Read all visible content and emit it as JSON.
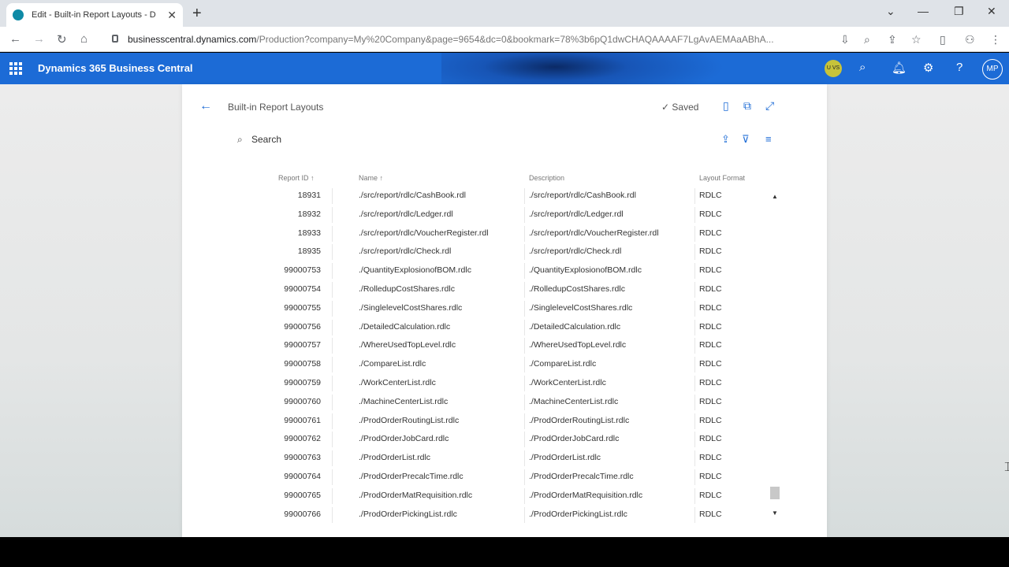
{
  "browser": {
    "tab_title": "Edit - Built-in Report Layouts - D",
    "tab_close": "✕",
    "new_tab": "+",
    "url_host": "businesscentral.dynamics.com",
    "url_path": "/Production?company=My%20Company&page=9654&dc=0&bookmark=78%3b6pQ1dwCHAQAAAAF7LgAvAEMAaABhA..."
  },
  "app": {
    "name": "Dynamics 365 Business Central",
    "company_badge": "U VS",
    "avatar_initials": "MP"
  },
  "page": {
    "title": "Built-in Report Layouts",
    "saved_label": "✓ Saved",
    "search_label": "Search"
  },
  "table": {
    "headers": {
      "report_id": "Report ID ↑",
      "name": "Name ↑",
      "description": "Description",
      "layout_format": "Layout Format"
    },
    "rows": [
      {
        "id": "18931",
        "name": "./src/report/rdlc/CashBook.rdl",
        "desc": "./src/report/rdlc/CashBook.rdl",
        "fmt": "RDLC"
      },
      {
        "id": "18932",
        "name": "./src/report/rdlc/Ledger.rdl",
        "desc": "./src/report/rdlc/Ledger.rdl",
        "fmt": "RDLC"
      },
      {
        "id": "18933",
        "name": "./src/report/rdlc/VoucherRegister.rdl",
        "desc": "./src/report/rdlc/VoucherRegister.rdl",
        "fmt": "RDLC"
      },
      {
        "id": "18935",
        "name": "./src/report/rdlc/Check.rdl",
        "desc": "./src/report/rdlc/Check.rdl",
        "fmt": "RDLC"
      },
      {
        "id": "99000753",
        "name": "./QuantityExplosionofBOM.rdlc",
        "desc": "./QuantityExplosionofBOM.rdlc",
        "fmt": "RDLC"
      },
      {
        "id": "99000754",
        "name": "./RolledupCostShares.rdlc",
        "desc": "./RolledupCostShares.rdlc",
        "fmt": "RDLC"
      },
      {
        "id": "99000755",
        "name": "./SinglelevelCostShares.rdlc",
        "desc": "./SinglelevelCostShares.rdlc",
        "fmt": "RDLC"
      },
      {
        "id": "99000756",
        "name": "./DetailedCalculation.rdlc",
        "desc": "./DetailedCalculation.rdlc",
        "fmt": "RDLC"
      },
      {
        "id": "99000757",
        "name": "./WhereUsedTopLevel.rdlc",
        "desc": "./WhereUsedTopLevel.rdlc",
        "fmt": "RDLC"
      },
      {
        "id": "99000758",
        "name": "./CompareList.rdlc",
        "desc": "./CompareList.rdlc",
        "fmt": "RDLC"
      },
      {
        "id": "99000759",
        "name": "./WorkCenterList.rdlc",
        "desc": "./WorkCenterList.rdlc",
        "fmt": "RDLC"
      },
      {
        "id": "99000760",
        "name": "./MachineCenterList.rdlc",
        "desc": "./MachineCenterList.rdlc",
        "fmt": "RDLC"
      },
      {
        "id": "99000761",
        "name": "./ProdOrderRoutingList.rdlc",
        "desc": "./ProdOrderRoutingList.rdlc",
        "fmt": "RDLC"
      },
      {
        "id": "99000762",
        "name": "./ProdOrderJobCard.rdlc",
        "desc": "./ProdOrderJobCard.rdlc",
        "fmt": "RDLC"
      },
      {
        "id": "99000763",
        "name": "./ProdOrderList.rdlc",
        "desc": "./ProdOrderList.rdlc",
        "fmt": "RDLC"
      },
      {
        "id": "99000764",
        "name": "./ProdOrderPrecalcTime.rdlc",
        "desc": "./ProdOrderPrecalcTime.rdlc",
        "fmt": "RDLC"
      },
      {
        "id": "99000765",
        "name": "./ProdOrderMatRequisition.rdlc",
        "desc": "./ProdOrderMatRequisition.rdlc",
        "fmt": "RDLC"
      },
      {
        "id": "99000766",
        "name": "./ProdOrderPickingList.rdlc",
        "desc": "./ProdOrderPickingList.rdlc",
        "fmt": "RDLC"
      }
    ]
  },
  "colors": {
    "app_bar": "#1c6bd6",
    "accent": "#1c6bd6"
  }
}
